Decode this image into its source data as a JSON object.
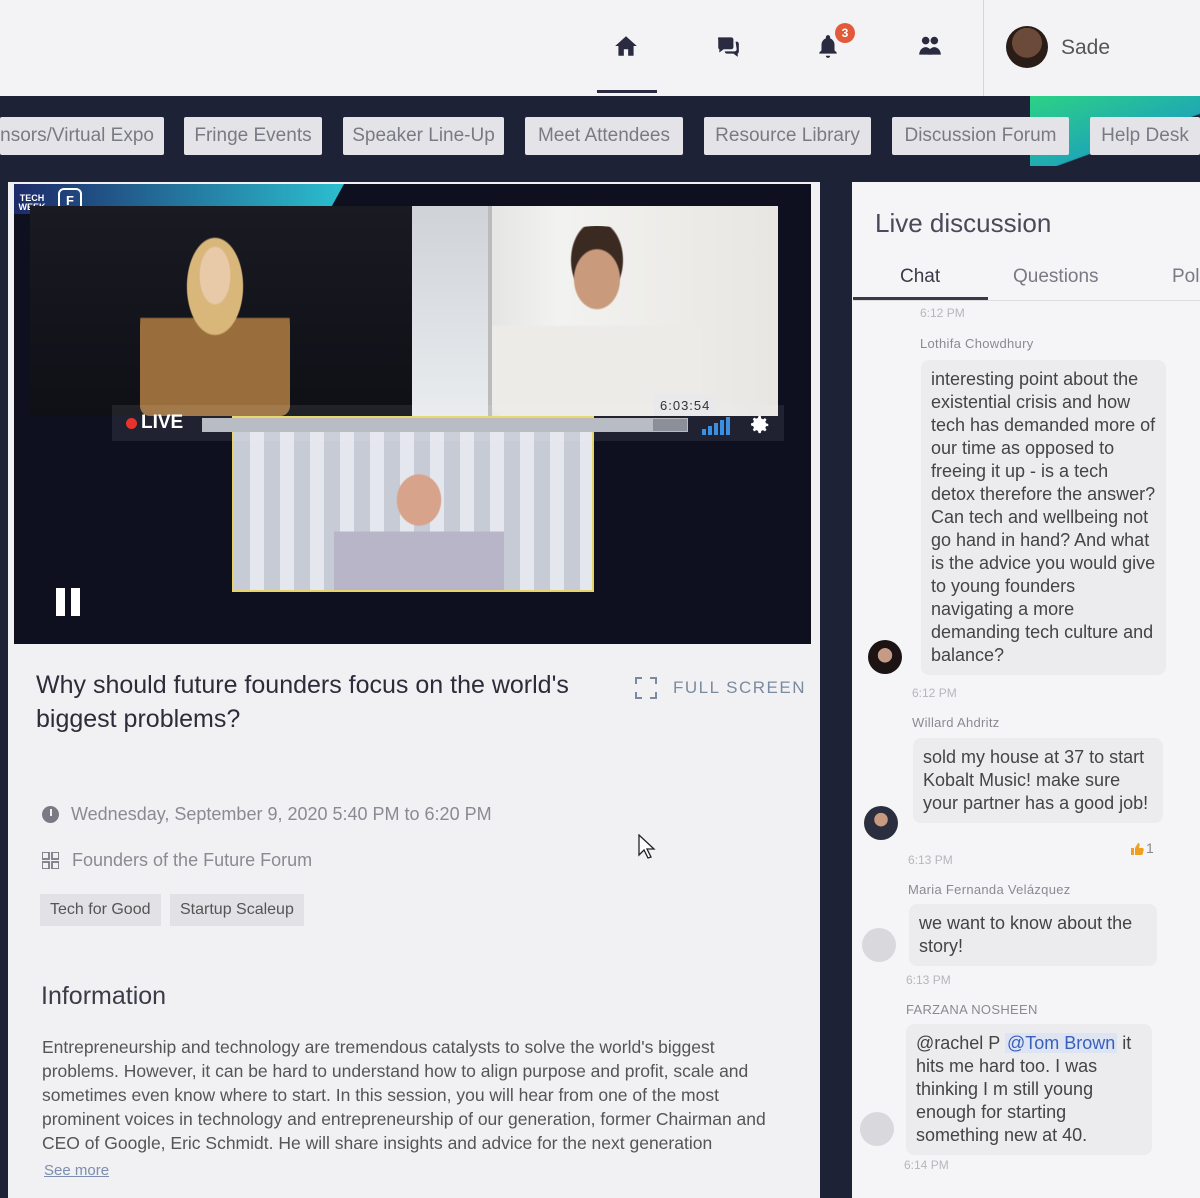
{
  "header": {
    "user_name": "Sade",
    "notification_count": "3",
    "nav": [
      {
        "name": "home-icon"
      },
      {
        "name": "chat-icon"
      },
      {
        "name": "bell-icon"
      },
      {
        "name": "people-icon"
      }
    ]
  },
  "menu": [
    {
      "label": "nsors/Virtual Expo"
    },
    {
      "label": "Fringe Events"
    },
    {
      "label": "Speaker Line-Up"
    },
    {
      "label": "Meet Attendees"
    },
    {
      "label": "Resource Library"
    },
    {
      "label": "Discussion Forum"
    },
    {
      "label": "Help Desk"
    }
  ],
  "video": {
    "live_label": "LIVE",
    "elapsed": "6:03:54",
    "progress": 0.93,
    "logo_tw": "TECH WEEK",
    "logo_f": "F"
  },
  "session": {
    "title": "Why should future founders focus on the world's biggest problems?",
    "fullscreen_label": "FULL SCREEN",
    "datetime": "Wednesday, September 9, 2020 5:40 PM to 6:20 PM",
    "forum": "Founders of the Future Forum",
    "tags": [
      "Tech for Good",
      "Startup Scaleup"
    ],
    "info_heading": "Information",
    "info_text": "Entrepreneurship and technology are tremendous catalysts to solve the world's biggest problems. However, it can be hard to understand how to align purpose and profit, scale and sometimes even know where to start. In this session, you will hear from one of the most prominent voices in technology and entrepreneurship of our generation, former Chairman and CEO of Google, Eric Schmidt. He will share insights and advice for the next generation",
    "see_more": "See more"
  },
  "discussion": {
    "title": "Live discussion",
    "tabs": [
      "Chat",
      "Questions",
      "Pol"
    ],
    "messages": [
      {
        "time_before": "6:12 PM",
        "author": "Lothifa Chowdhury",
        "text": "interesting point about the existential crisis and how tech has demanded more of our time as opposed to freeing it up - is a tech detox therefore the answer? Can tech and wellbeing not go hand in hand? And what is the advice you would give to young founders navigating a more demanding tech culture and balance?",
        "time": "6:12 PM"
      },
      {
        "author": "Willard Ahdritz",
        "text": "sold my house at 37 to start Kobalt Music! make sure your partner has a good job!",
        "time": "6:13 PM",
        "likes": "1"
      },
      {
        "author": "Maria Fernanda Velázquez",
        "text": "we want to know about the story!",
        "time": "6:13 PM"
      },
      {
        "author": "FARZANA NOSHEEN",
        "text_prefix": "@rachel P ",
        "mention": "@Tom Brown",
        "text_suffix": " it hits me hard too. I was thinking I m still young enough for starting something new at 40.",
        "time": "6:14 PM"
      }
    ]
  },
  "colors": {
    "dark_band": "#1e2236",
    "accent_green": "#2ee58d",
    "live_red": "#e8332a",
    "badge": "#e35a3a"
  }
}
